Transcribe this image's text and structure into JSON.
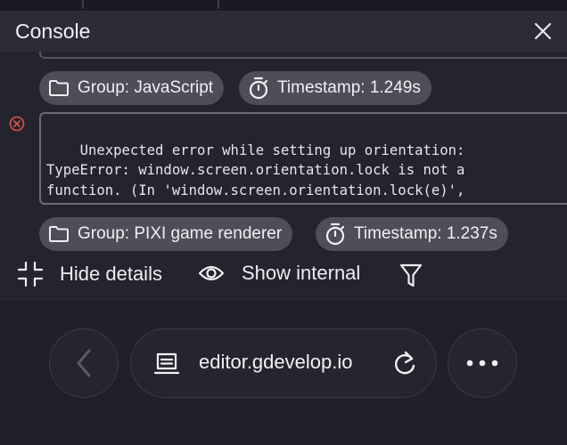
{
  "console": {
    "title": "Console",
    "entries": [
      {
        "group_label": "Group: JavaScript",
        "timestamp_label": "Timestamp: 1.249s"
      },
      {
        "level": "error",
        "message": "Unexpected error while setting up orientation:\nTypeError: window.screen.orientation.lock is not a\nfunction. (In 'window.screen.orientation.lock(e)',\n'window.screen.orientation.lock' is undefined)",
        "group_label": "Group: PIXI game renderer",
        "timestamp_label": "Timestamp: 1.237s"
      }
    ],
    "actions": {
      "hide_details": "Hide details",
      "show_internal": "Show internal"
    },
    "icons": [
      "close-icon",
      "folder-icon",
      "stopwatch-icon",
      "error-circle-icon",
      "collapse-icon",
      "eye-icon",
      "filter-icon"
    ]
  },
  "browser_bar": {
    "url": "editor.gdevelop.io",
    "icons": [
      "back-arrow-icon",
      "page-icon",
      "reload-icon",
      "more-icon"
    ]
  },
  "colors": {
    "error": "#e0524a",
    "chip_bg": "#4d4e58",
    "panel_bg": "#23242e"
  }
}
